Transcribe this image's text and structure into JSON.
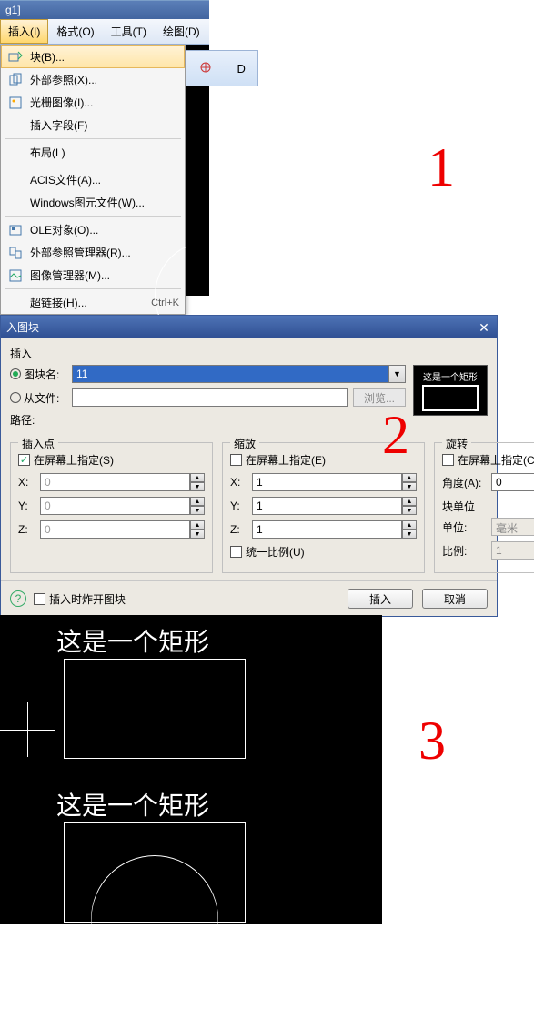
{
  "title_frag": "g1]",
  "menubar": {
    "insert": "插入(I)",
    "format": "格式(O)",
    "tools": "工具(T)",
    "draw": "绘图(D)"
  },
  "dropdown": {
    "block": "块(B)...",
    "xref": "外部参照(X)...",
    "raster": "光栅图像(I)...",
    "field": "插入字段(F)",
    "layout": "布局(L)",
    "acis": "ACIS文件(A)...",
    "wmf": "Windows图元文件(W)...",
    "ole": "OLE对象(O)...",
    "xrefmgr": "外部参照管理器(R)...",
    "imgmgr": "图像管理器(M)...",
    "hyperlink": "超链接(H)...",
    "hyperlink_accel": "Ctrl+K"
  },
  "toolbar_frag": {
    "letter": "D"
  },
  "annot": {
    "n1": "1",
    "n2": "2",
    "n3": "3"
  },
  "dialog": {
    "title": "入图块",
    "insert_label": "插入",
    "block_name_label": "图块名:",
    "block_name_value": "11",
    "from_file_label": "从文件:",
    "from_file_value": "",
    "path_label": "路径:",
    "browse": "浏览...",
    "preview_text": "这是一个矩形",
    "groups": {
      "insert_point": {
        "title": "插入点",
        "onscreen": "在屏幕上指定(S)",
        "x": "X:",
        "y": "Y:",
        "z": "Z:",
        "xv": "0",
        "yv": "0",
        "zv": "0"
      },
      "scale": {
        "title": "缩放",
        "onscreen": "在屏幕上指定(E)",
        "x": "X:",
        "y": "Y:",
        "z": "Z:",
        "xv": "1",
        "yv": "1",
        "zv": "1",
        "uniform": "统一比例(U)"
      },
      "rotate": {
        "title": "旋转",
        "onscreen": "在屏幕上指定(C)",
        "angle": "角度(A):",
        "angle_val": "0",
        "block_unit_title": "块单位",
        "unit_label": "单位:",
        "unit_val": "毫米",
        "ratio_label": "比例:",
        "ratio_val": "1"
      }
    },
    "explode": "插入时炸开图块",
    "insert_btn": "插入",
    "cancel_btn": "取消"
  },
  "canvas3": {
    "text1": "这是一个矩形",
    "text2": "这是一个矩形"
  }
}
